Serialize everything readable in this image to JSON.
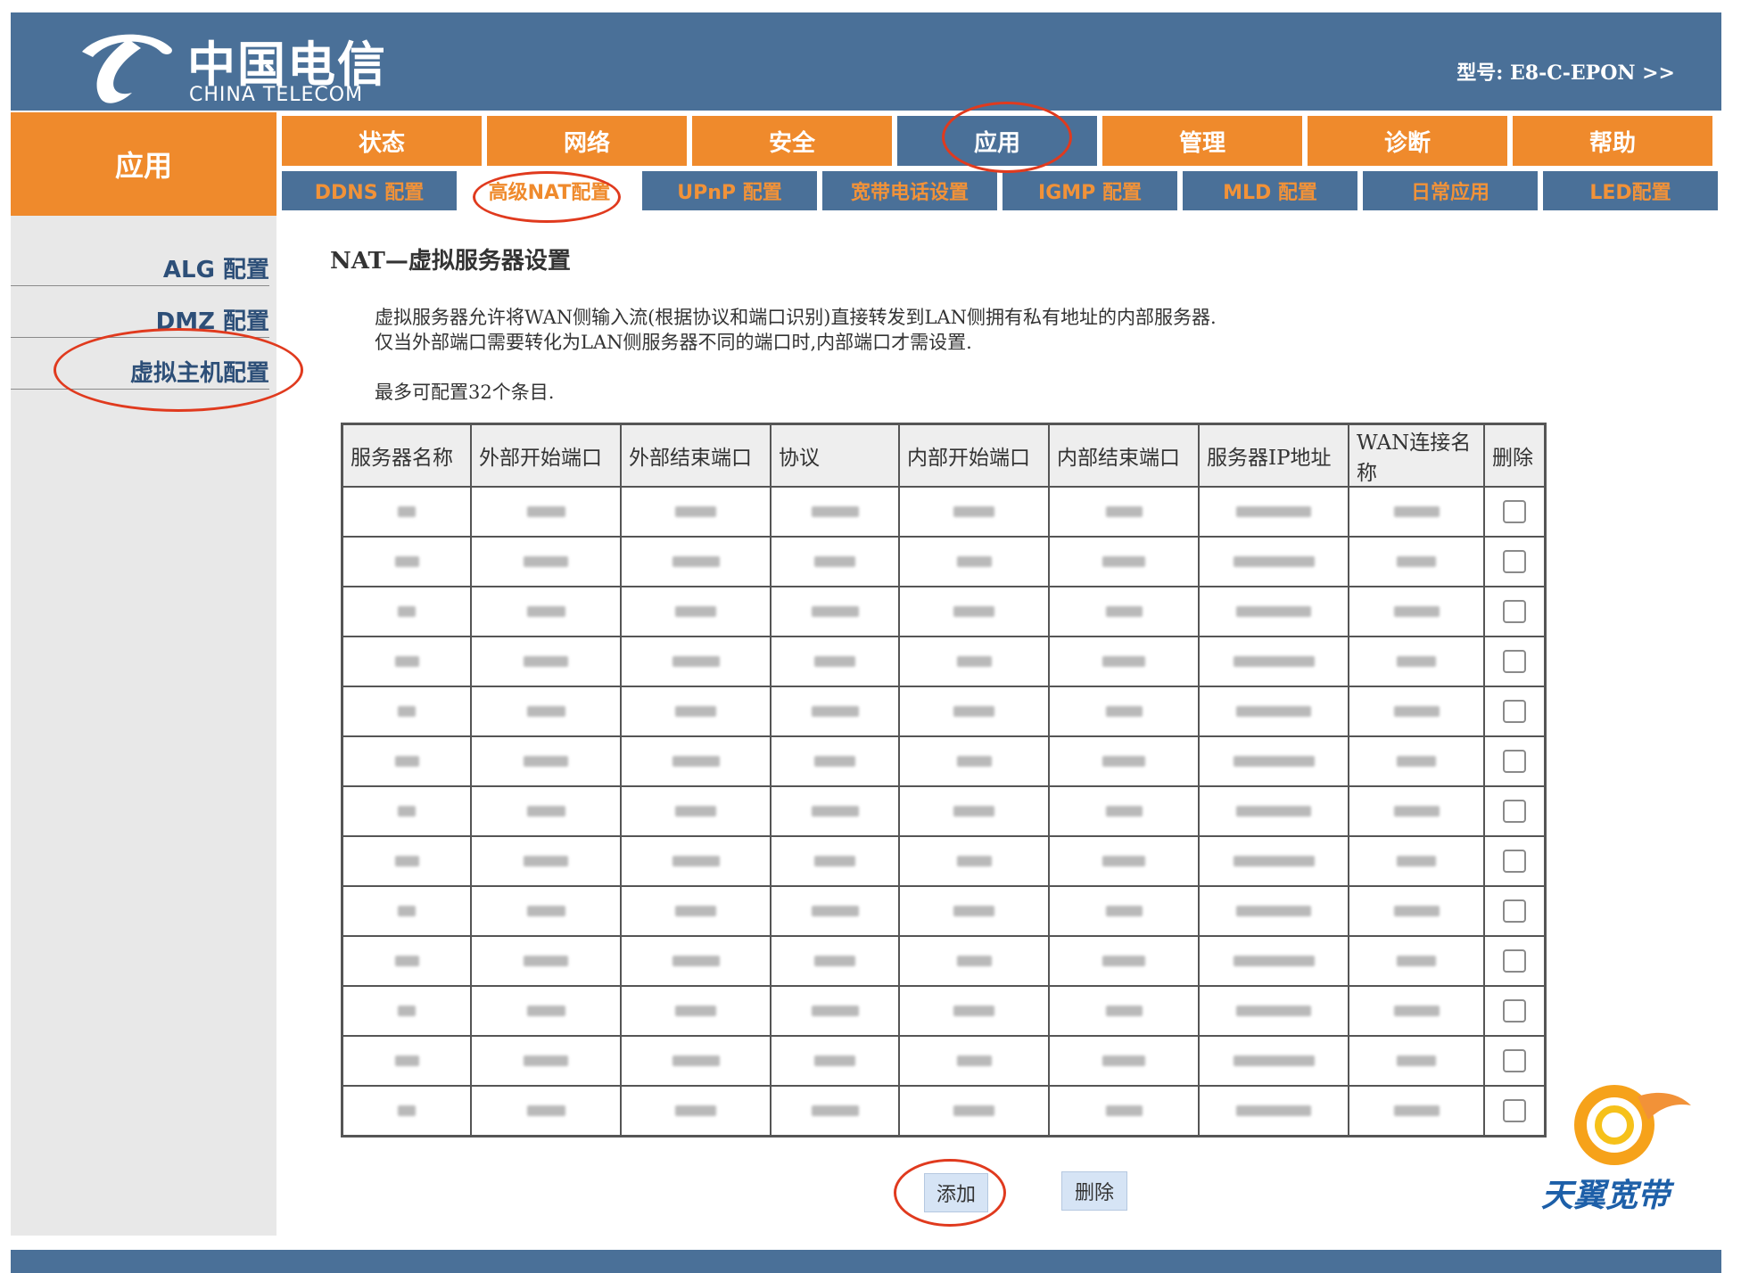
{
  "header": {
    "logo_cn": "中国电信",
    "logo_en": "CHINA TELECOM",
    "model": "型号: E8-C-EPON >>"
  },
  "section_title": "应用",
  "main_nav": [
    {
      "label": "状态",
      "active": false
    },
    {
      "label": "网络",
      "active": false
    },
    {
      "label": "安全",
      "active": false
    },
    {
      "label": "应用",
      "active": true
    },
    {
      "label": "管理",
      "active": false
    },
    {
      "label": "诊断",
      "active": false
    },
    {
      "label": "帮助",
      "active": false
    }
  ],
  "sub_nav": [
    {
      "label": "DDNS 配置",
      "active": false
    },
    {
      "label": "高级NAT配置",
      "active": true
    },
    {
      "label": "UPnP 配置",
      "active": false
    },
    {
      "label": "宽带电话设置",
      "active": false
    },
    {
      "label": "IGMP 配置",
      "active": false
    },
    {
      "label": "MLD 配置",
      "active": false
    },
    {
      "label": "日常应用",
      "active": false
    },
    {
      "label": "LED配置",
      "active": false
    }
  ],
  "sidebar": {
    "items": [
      {
        "label": "ALG 配置"
      },
      {
        "label": "DMZ 配置"
      },
      {
        "label": "虚拟主机配置"
      }
    ]
  },
  "page": {
    "title": "NAT—虚拟服务器设置",
    "desc_line1": "虚拟服务器允许将WAN侧输入流(根据协议和端口识别)直接转发到LAN侧拥有私有地址的内部服务器.",
    "desc_line2": "仅当外部端口需要转化为LAN侧服务器不同的端口时,内部端口才需设置.",
    "max_entries": "最多可配置32个条目."
  },
  "table": {
    "headers": [
      "服务器名称",
      "外部开始端口",
      "外部结束端口",
      "协议",
      "内部开始端口",
      "内部结束端口",
      "服务器IP地址",
      "WAN连接名称",
      "删除"
    ],
    "row_count": 13
  },
  "buttons": {
    "add": "添加",
    "delete": "删除"
  },
  "brand": {
    "text": "天翼宽带"
  },
  "colors": {
    "header_blue": "#4a7098",
    "nav_orange": "#ef8a2c",
    "annotation_red": "#e03a1e"
  }
}
